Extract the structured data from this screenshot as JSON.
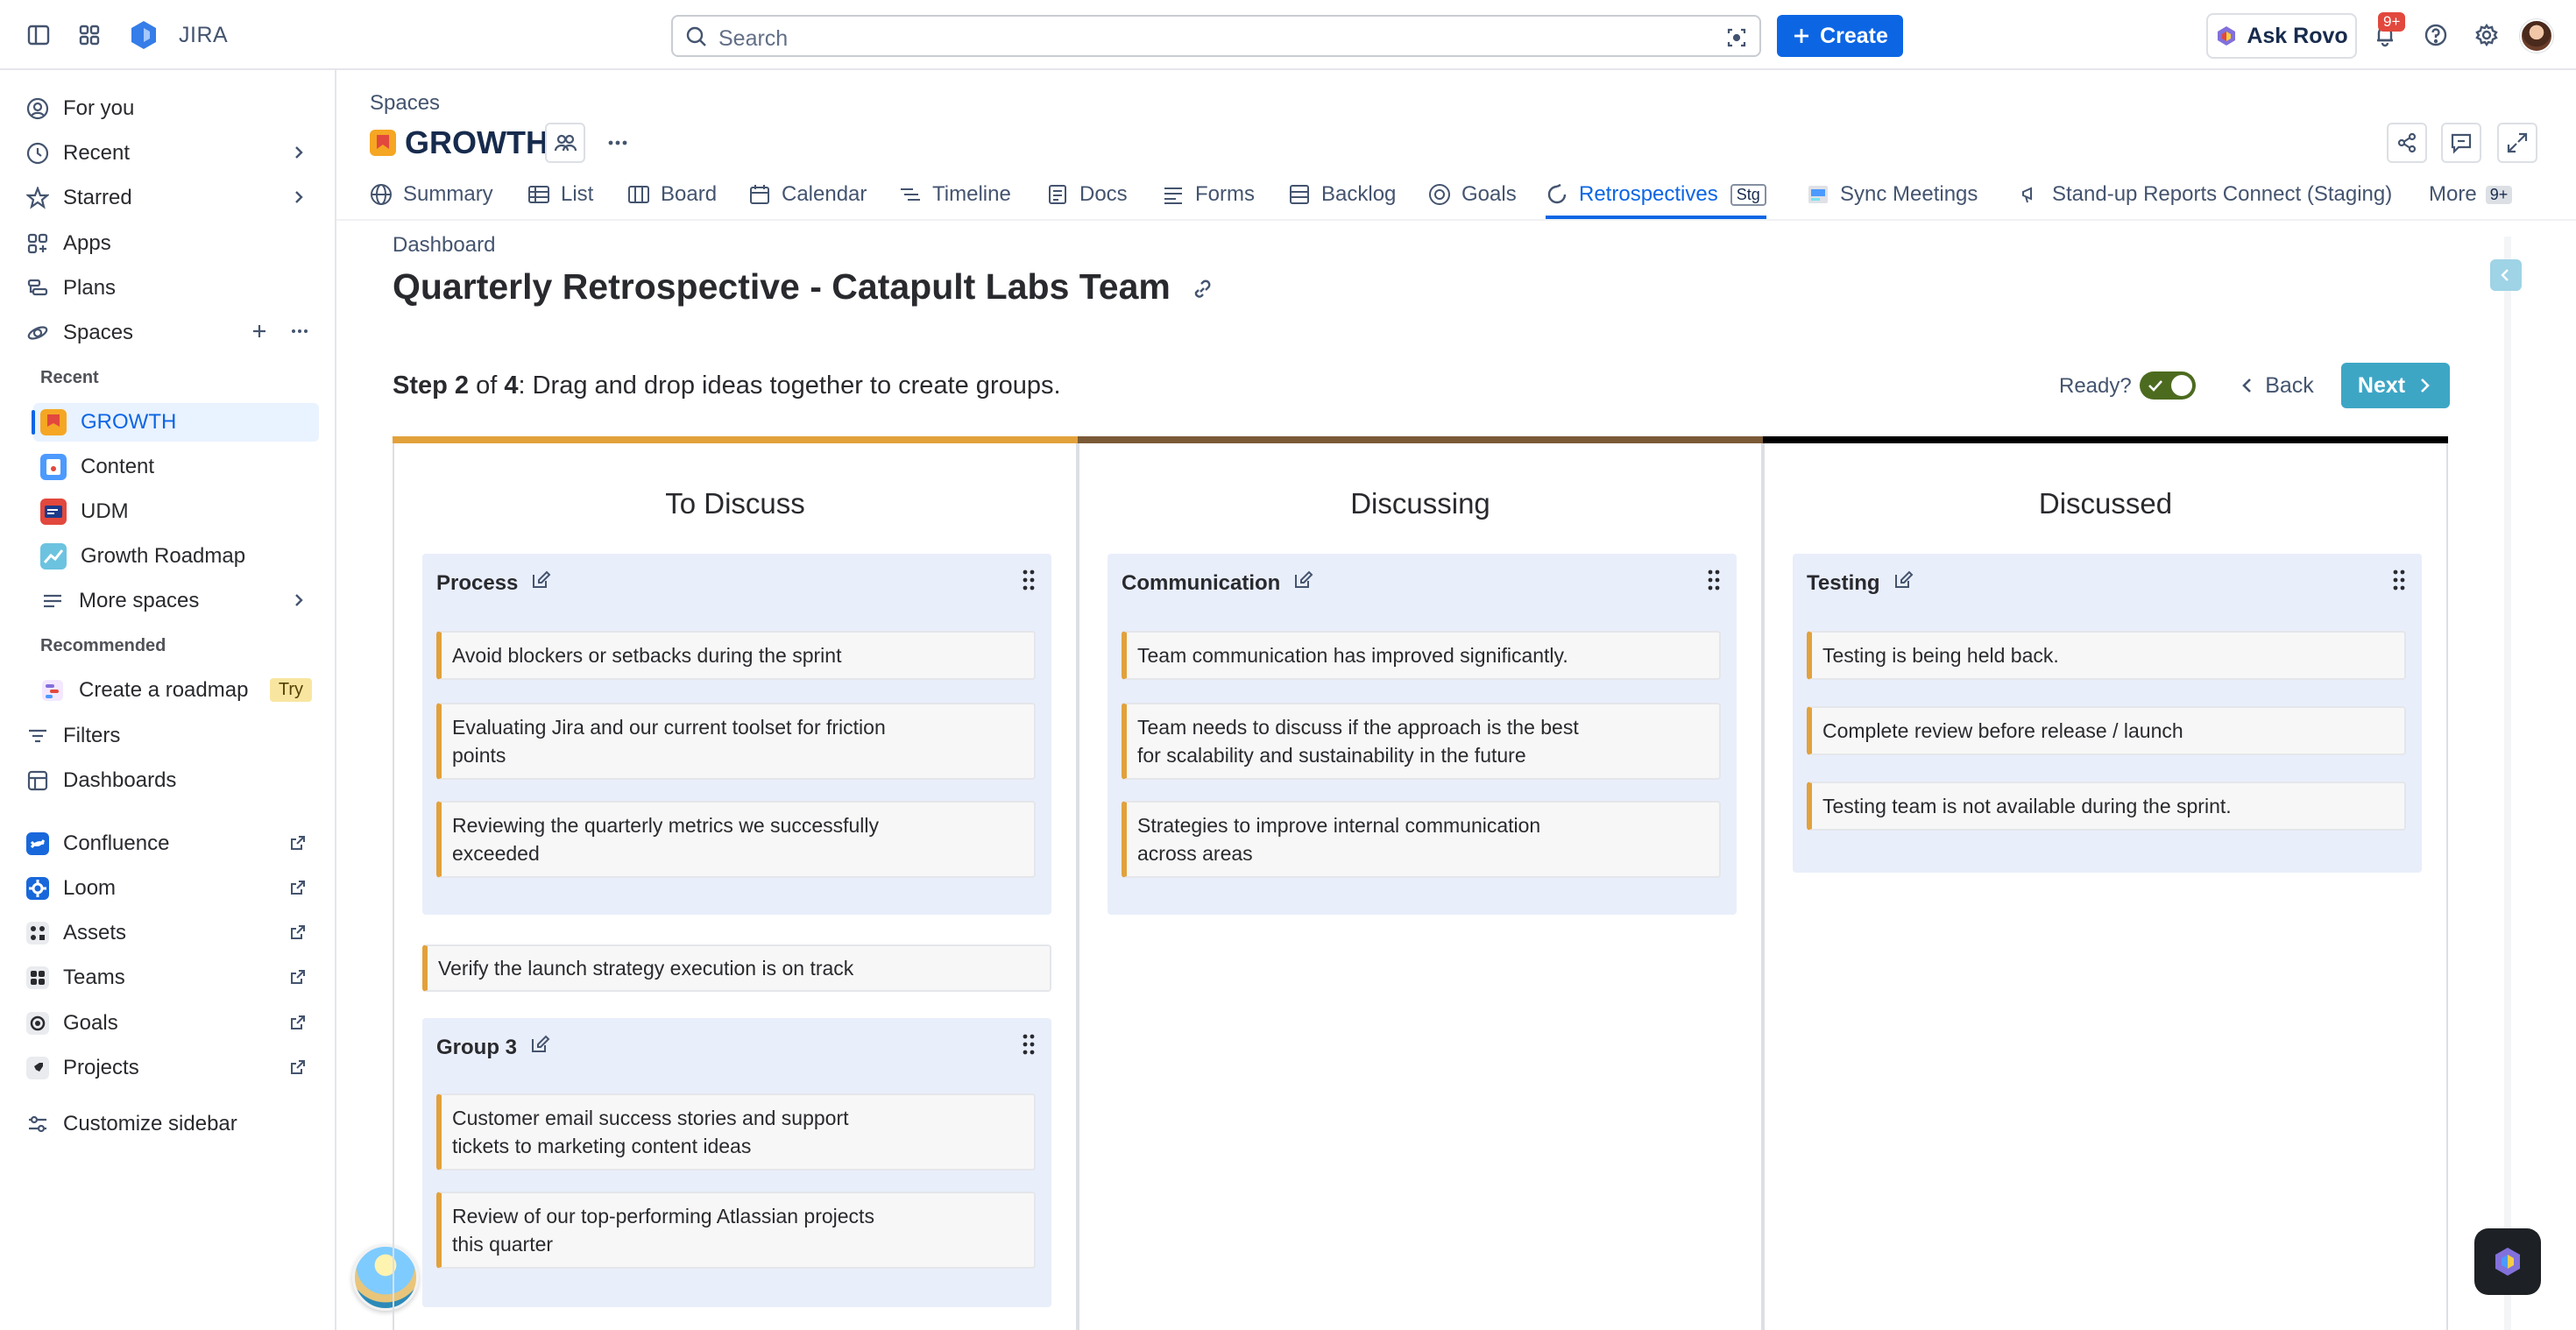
{
  "app": {
    "name": "JIRA"
  },
  "topbar": {
    "search_placeholder": "Search",
    "create_label": "Create",
    "ask_rovo_label": "Ask Rovo",
    "notifications_badge": "9+"
  },
  "sidebar": {
    "items": [
      {
        "label": "For you",
        "icon": "user-circle-icon"
      },
      {
        "label": "Recent",
        "icon": "clock-icon"
      },
      {
        "label": "Starred",
        "icon": "star-icon"
      },
      {
        "label": "Apps",
        "icon": "apps-icon"
      },
      {
        "label": "Plans",
        "icon": "plans-icon"
      },
      {
        "label": "Spaces",
        "icon": "spaces-icon"
      }
    ],
    "recent_header": "Recent",
    "spaces": [
      {
        "label": "GROWTH",
        "color": "#f5a623"
      },
      {
        "label": "Content",
        "color": "#4c9aff"
      },
      {
        "label": "UDM",
        "color": "#e2483d"
      },
      {
        "label": "Growth Roadmap",
        "color": "#6cc3e0"
      }
    ],
    "more_spaces": "More spaces",
    "recommended_header": "Recommended",
    "create_roadmap": "Create a roadmap",
    "try_badge": "Try",
    "filters": "Filters",
    "dashboards": "Dashboards",
    "apps_links": [
      {
        "label": "Confluence",
        "icon": "confluence-icon"
      },
      {
        "label": "Loom",
        "icon": "loom-icon"
      },
      {
        "label": "Assets",
        "icon": "assets-icon"
      },
      {
        "label": "Teams",
        "icon": "teams-icon"
      },
      {
        "label": "Goals",
        "icon": "goals-icon"
      },
      {
        "label": "Projects",
        "icon": "projects-icon"
      }
    ],
    "customize": "Customize sidebar"
  },
  "header": {
    "breadcrumb": "Spaces",
    "project_title": "GROWTH",
    "tabs": [
      {
        "label": "Summary"
      },
      {
        "label": "List"
      },
      {
        "label": "Board"
      },
      {
        "label": "Calendar"
      },
      {
        "label": "Timeline"
      },
      {
        "label": "Docs"
      },
      {
        "label": "Forms"
      },
      {
        "label": "Backlog"
      },
      {
        "label": "Goals"
      },
      {
        "label": "Retrospectives",
        "tag": "Stg"
      },
      {
        "label": "Sync Meetings"
      },
      {
        "label": "Stand-up Reports Connect (Staging)"
      },
      {
        "label": "More",
        "tag": "9+"
      }
    ]
  },
  "content": {
    "breadcrumb": "Dashboard",
    "title": "Quarterly Retrospective - Catapult Labs Team",
    "step_bold": "Step 2",
    "step_of": " of ",
    "step_total": "4",
    "step_text": ": Drag and drop ideas together to create groups.",
    "ready_label": "Ready?",
    "back_label": "Back",
    "next_label": "Next",
    "colors": {
      "to_discuss": "#e2a13b",
      "discussing": "#7a5a36",
      "discussed": "#000000",
      "card_accent": "#e2a13b"
    }
  },
  "columns": [
    {
      "title": "To Discuss",
      "groups": [
        {
          "name": "Process",
          "cards": [
            "Avoid blockers or setbacks during the sprint",
            "Evaluating Jira and our current toolset for friction points",
            "Reviewing the quarterly metrics we successfully exceeded"
          ]
        },
        {
          "name": "Group 3",
          "cards": [
            "Customer email success stories and support tickets to marketing content ideas",
            "Review of our top-performing Atlassian projects this quarter"
          ]
        }
      ],
      "loose_card": "Verify the launch strategy execution is on track"
    },
    {
      "title": "Discussing",
      "groups": [
        {
          "name": "Communication",
          "cards": [
            "Team communication has improved significantly.",
            "Team needs to discuss if the approach is the best for scalability and sustainability in the future",
            "Strategies to improve internal communication across areas"
          ]
        }
      ]
    },
    {
      "title": "Discussed",
      "groups": [
        {
          "name": "Testing",
          "cards": [
            "Testing is being held back.",
            "Complete review before release / launch",
            "Testing team is not available during the sprint."
          ]
        }
      ]
    }
  ]
}
